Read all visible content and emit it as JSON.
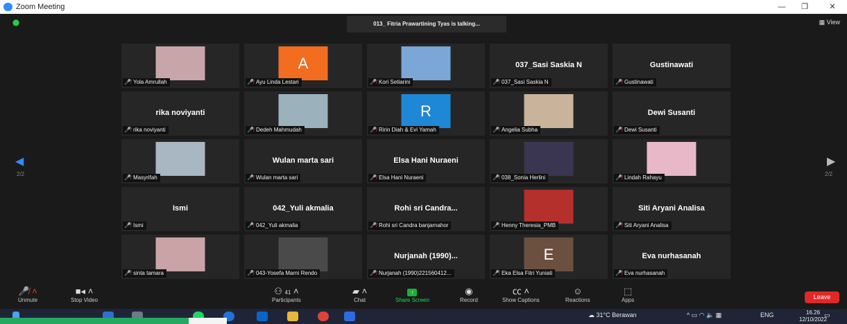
{
  "window": {
    "title": "Zoom Meeting",
    "controls": [
      "—",
      "❐",
      "✕"
    ]
  },
  "top": {
    "talking": "013_ Fitria Prawartining Tyas is talking...",
    "view_label": "View"
  },
  "nav": {
    "page": "2/2"
  },
  "tiles": [
    {
      "label": "Yola Amrullah",
      "kind": "photo",
      "color": "#c7a5a8"
    },
    {
      "label": "Ayu Linda Lestari",
      "kind": "letter",
      "letter": "A",
      "color": "#f36d21"
    },
    {
      "label": "Kori Setiarini",
      "kind": "photo",
      "color": "#7aa6d8"
    },
    {
      "label": "037_Sasi Saskia N",
      "kind": "name",
      "name": "037_Sasi Saskia N"
    },
    {
      "label": "Gustinawati",
      "kind": "name",
      "name": "Gustinawati"
    },
    {
      "label": "rika noviyanti",
      "kind": "name",
      "name": "rika noviyanti"
    },
    {
      "label": "Dedeh Mahmudah",
      "kind": "photo",
      "color": "#9bb2bd"
    },
    {
      "label": "Ririn Diah & Evi Yamah",
      "kind": "letter",
      "letter": "R",
      "color": "#1e88d6"
    },
    {
      "label": "Angelia Subha",
      "kind": "photo",
      "color": "#c9b39a"
    },
    {
      "label": "Dewi Susanti",
      "kind": "name",
      "name": "Dewi Susanti"
    },
    {
      "label": "Masyrifah",
      "kind": "photo",
      "color": "#a9b7c2"
    },
    {
      "label": "Wulan marta sari",
      "kind": "name",
      "name": "Wulan marta sari"
    },
    {
      "label": "Elsa Hani Nuraeni",
      "kind": "name",
      "name": "Elsa Hani Nuraeni"
    },
    {
      "label": "038_Sonia Herlini",
      "kind": "photo",
      "color": "#3a3550"
    },
    {
      "label": "Lindah Rahayu",
      "kind": "photo",
      "color": "#e8b8c8"
    },
    {
      "label": "Ismi",
      "kind": "name",
      "name": "Ismi"
    },
    {
      "label": "042_Yuli akmalia",
      "kind": "name",
      "name": "042_Yuli akmalia"
    },
    {
      "label": "Rohi sri Candra banjarnahor",
      "kind": "name",
      "name": "Rohi sri Candra..."
    },
    {
      "label": "Henny Theresia_PMB",
      "kind": "photo",
      "color": "#b4302c"
    },
    {
      "label": "Siti Aryani Analisa",
      "kind": "name",
      "name": "Siti Aryani Analisa"
    },
    {
      "label": "sinta tamara",
      "kind": "photo",
      "color": "#c9a3a6"
    },
    {
      "label": "043-Yosefa Marni Rendo",
      "kind": "photo",
      "color": "#4a4a4a"
    },
    {
      "label": "Nurjanah (1990)221560412...",
      "kind": "name",
      "name": "Nurjanah (1990)..."
    },
    {
      "label": "Eka Elsa Fitri Yuniati",
      "kind": "letter",
      "letter": "E",
      "color": "#6b5040"
    },
    {
      "label": "Eva nurhasanah",
      "kind": "name",
      "name": "Eva nurhasanah"
    }
  ],
  "toolbar": {
    "unmute": "Unmute",
    "stop_video": "Stop Video",
    "participants": "Participants",
    "participants_count": "41",
    "chat": "Chat",
    "share_screen": "Share Screen",
    "record": "Record",
    "show_captions": "Show Captions",
    "reactions": "Reactions",
    "apps": "Apps",
    "leave": "Leave"
  },
  "taskbar": {
    "weather": "31°C  Berawan",
    "lang": "ENG",
    "time": "16.26",
    "date": "12/10/2022"
  }
}
